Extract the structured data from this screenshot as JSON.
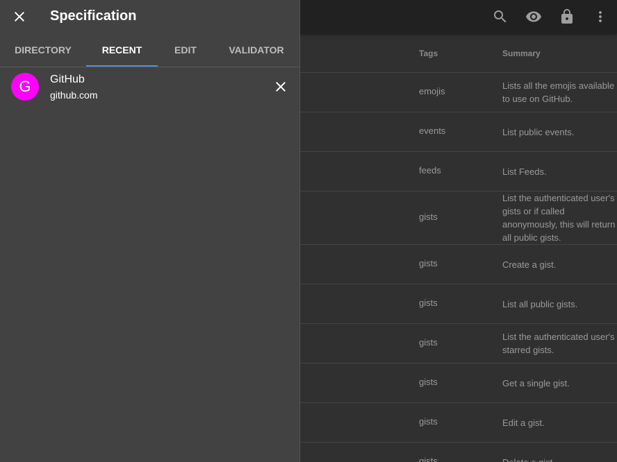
{
  "drawer": {
    "title": "Specification",
    "tabs": [
      {
        "label": "DIRECTORY",
        "active": false
      },
      {
        "label": "RECENT",
        "active": true
      },
      {
        "label": "EDIT",
        "active": false
      },
      {
        "label": "VALIDATOR",
        "active": false
      }
    ],
    "recent": [
      {
        "avatar_letter": "G",
        "avatar_color": "#ff00ff",
        "name": "GitHub",
        "url": "github.com"
      }
    ]
  },
  "toolbar": {
    "icons": [
      "search-icon",
      "eye-icon",
      "lock-icon",
      "more-vert-icon"
    ]
  },
  "table": {
    "headers": {
      "tags": "Tags",
      "summary": "Summary"
    },
    "rows": [
      {
        "tag": "emojis",
        "summary": "Lists all the emojis available to use on GitHub."
      },
      {
        "tag": "events",
        "summary": "List public events."
      },
      {
        "tag": "feeds",
        "summary": "List Feeds."
      },
      {
        "tag": "gists",
        "summary": "List the authenticated user's gists or if called anonymously, this will return all public gists."
      },
      {
        "tag": "gists",
        "summary": "Create a gist."
      },
      {
        "tag": "gists",
        "summary": "List all public gists."
      },
      {
        "tag": "gists",
        "summary": "List the authenticated user's starred gists."
      },
      {
        "tag": "gists",
        "summary": "Get a single gist."
      },
      {
        "tag": "gists",
        "summary": "Edit a gist."
      },
      {
        "tag": "gists",
        "summary": "Delete a gist."
      }
    ]
  }
}
